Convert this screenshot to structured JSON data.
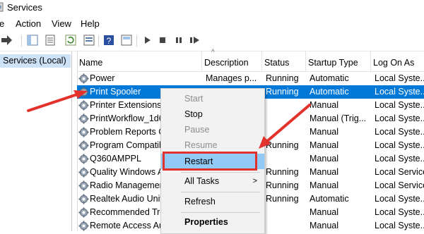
{
  "window": {
    "title": "Services"
  },
  "menu": [
    "e",
    "Action",
    "View",
    "Help"
  ],
  "left_pane": {
    "selected": "Services (Local)"
  },
  "columns": [
    "Name",
    "Description",
    "Status",
    "Startup Type",
    "Log On As"
  ],
  "rows": [
    {
      "name": "Power",
      "description": "Manages p...",
      "status": "Running",
      "startup": "Automatic",
      "logon": "Local Syste..."
    },
    {
      "name": "Print Spooler",
      "description": "",
      "status": "Running",
      "startup": "Automatic",
      "logon": "Local Syste...",
      "selected": true
    },
    {
      "name": "Printer Extensions a",
      "description": "",
      "status": "",
      "startup": "Manual",
      "logon": "Local Syste..."
    },
    {
      "name": "PrintWorkflow_1d6",
      "description": "",
      "status": "",
      "startup": "Manual (Trig...",
      "logon": "Local Syste..."
    },
    {
      "name": "Problem Reports C",
      "description": "",
      "status": "",
      "startup": "Manual",
      "logon": "Local Syste..."
    },
    {
      "name": "Program Compatib",
      "description": "",
      "status": "Running",
      "startup": "Manual",
      "logon": "Local Syste..."
    },
    {
      "name": "Q360AMPPL",
      "description": "",
      "status": "",
      "startup": "Manual",
      "logon": "Local Syste..."
    },
    {
      "name": "Quality Windows A",
      "description": "",
      "status": "Running",
      "startup": "Manual",
      "logon": "Local Service"
    },
    {
      "name": "Radio Managemen",
      "description": "",
      "status": "Running",
      "startup": "Manual",
      "logon": "Local Service"
    },
    {
      "name": "Realtek Audio Univ",
      "description": "",
      "status": "Running",
      "startup": "Automatic",
      "logon": "Local Syste..."
    },
    {
      "name": "Recommended Troi",
      "description": "",
      "status": "",
      "startup": "Manual",
      "logon": "Local Syste..."
    },
    {
      "name": "Remote Access Au",
      "description": "",
      "status": "",
      "startup": "Manual",
      "logon": "Local Syste..."
    }
  ],
  "context_menu": {
    "start": "Start",
    "stop": "Stop",
    "pause": "Pause",
    "resume": "Resume",
    "restart": "Restart",
    "all_tasks": "All Tasks",
    "all_tasks_arrow": ">",
    "refresh": "Refresh",
    "properties": "Properties"
  },
  "colors": {
    "selection": "#0078d7",
    "highlight": "#91c9f7",
    "annotation": "#e3312b"
  }
}
